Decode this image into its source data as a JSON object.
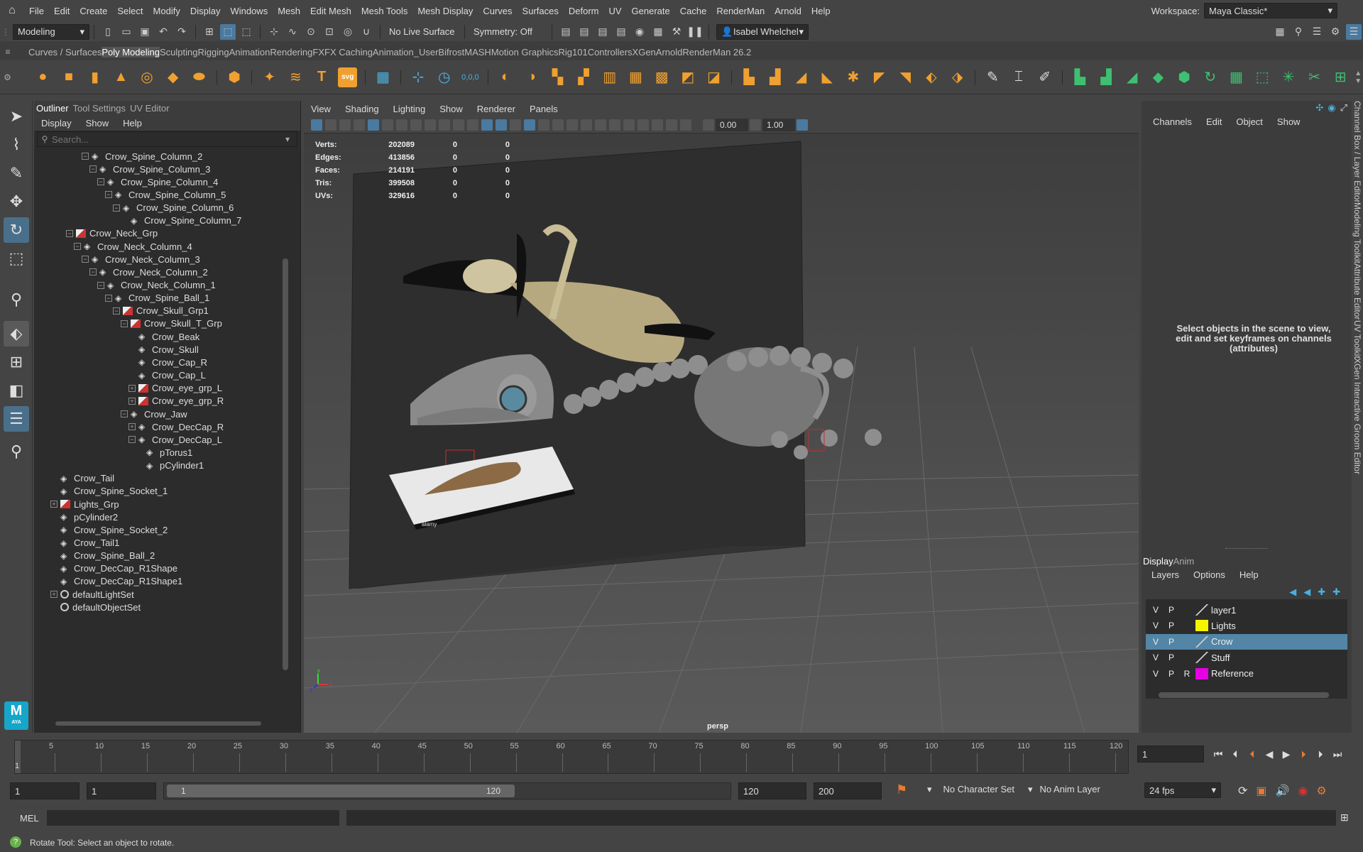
{
  "menubar": {
    "items": [
      "File",
      "Edit",
      "Create",
      "Select",
      "Modify",
      "Display",
      "Windows",
      "Mesh",
      "Edit Mesh",
      "Mesh Tools",
      "Mesh Display",
      "Curves",
      "Surfaces",
      "Deform",
      "UV",
      "Generate",
      "Cache",
      "RenderMan",
      "Arnold",
      "Help"
    ],
    "workspace_label": "Workspace:",
    "workspace_value": "Maya Classic*"
  },
  "statusline": {
    "mode": "Modeling",
    "live_surface": "No Live Surface",
    "symmetry": "Symmetry: Off",
    "user": "Isabel Whelchel"
  },
  "shelf": {
    "tabs": [
      "Curves / Surfaces",
      "Poly Modeling",
      "Sculpting",
      "Rigging",
      "Animation",
      "Rendering",
      "FX",
      "FX Caching",
      "Animation_User",
      "Bifrost",
      "MASH",
      "Motion Graphics",
      "Rig101",
      "Controllers",
      "XGen",
      "Arnold",
      "RenderMan 26.2"
    ],
    "active_tab": "Poly Modeling"
  },
  "outliner": {
    "tabs": [
      "Outliner",
      "Tool Settings",
      "UV Editor"
    ],
    "menu": [
      "Display",
      "Show",
      "Help"
    ],
    "search_placeholder": "Search...",
    "rows": [
      {
        "label": "Crow_Spine_Column_2",
        "indent": 5,
        "icon": "mesh",
        "toggle": "−"
      },
      {
        "label": "Crow_Spine_Column_3",
        "indent": 6,
        "icon": "mesh",
        "toggle": "−"
      },
      {
        "label": "Crow_Spine_Column_4",
        "indent": 7,
        "icon": "mesh",
        "toggle": "−"
      },
      {
        "label": "Crow_Spine_Column_5",
        "indent": 8,
        "icon": "mesh",
        "toggle": "−"
      },
      {
        "label": "Crow_Spine_Column_6",
        "indent": 9,
        "icon": "mesh",
        "toggle": "−"
      },
      {
        "label": "Crow_Spine_Column_7",
        "indent": 10,
        "icon": "mesh",
        "toggle": ""
      },
      {
        "label": "Crow_Neck_Grp",
        "indent": 3,
        "icon": "group",
        "toggle": "−"
      },
      {
        "label": "Crow_Neck_Column_4",
        "indent": 4,
        "icon": "mesh",
        "toggle": "−"
      },
      {
        "label": "Crow_Neck_Column_3",
        "indent": 5,
        "icon": "mesh",
        "toggle": "−"
      },
      {
        "label": "Crow_Neck_Column_2",
        "indent": 6,
        "icon": "mesh",
        "toggle": "−"
      },
      {
        "label": "Crow_Neck_Column_1",
        "indent": 7,
        "icon": "mesh",
        "toggle": "−"
      },
      {
        "label": "Crow_Spine_Ball_1",
        "indent": 8,
        "icon": "mesh",
        "toggle": "−"
      },
      {
        "label": "Crow_Skull_Grp1",
        "indent": 9,
        "icon": "group",
        "toggle": "−"
      },
      {
        "label": "Crow_Skull_T_Grp",
        "indent": 10,
        "icon": "group",
        "toggle": "−"
      },
      {
        "label": "Crow_Beak",
        "indent": 11,
        "icon": "mesh",
        "toggle": ""
      },
      {
        "label": "Crow_Skull",
        "indent": 11,
        "icon": "mesh",
        "toggle": ""
      },
      {
        "label": "Crow_Cap_R",
        "indent": 11,
        "icon": "mesh",
        "toggle": ""
      },
      {
        "label": "Crow_Cap_L",
        "indent": 11,
        "icon": "mesh",
        "toggle": ""
      },
      {
        "label": "Crow_eye_grp_L",
        "indent": 11,
        "icon": "group",
        "toggle": "+"
      },
      {
        "label": "Crow_eye_grp_R",
        "indent": 11,
        "icon": "group",
        "toggle": "+"
      },
      {
        "label": "Crow_Jaw",
        "indent": 10,
        "icon": "mesh",
        "toggle": "−"
      },
      {
        "label": "Crow_DecCap_R",
        "indent": 11,
        "icon": "mesh",
        "toggle": "+"
      },
      {
        "label": "Crow_DecCap_L",
        "indent": 11,
        "icon": "mesh",
        "toggle": "−"
      },
      {
        "label": "pTorus1",
        "indent": 12,
        "icon": "mesh",
        "toggle": ""
      },
      {
        "label": "pCylinder1",
        "indent": 12,
        "icon": "mesh",
        "toggle": ""
      },
      {
        "label": "Crow_Tail",
        "indent": 1,
        "icon": "mesh",
        "toggle": ""
      },
      {
        "label": "Crow_Spine_Socket_1",
        "indent": 1,
        "icon": "mesh",
        "toggle": ""
      },
      {
        "label": "Lights_Grp",
        "indent": 1,
        "icon": "group",
        "toggle": "+"
      },
      {
        "label": "pCylinder2",
        "indent": 1,
        "icon": "mesh",
        "toggle": ""
      },
      {
        "label": "Crow_Spine_Socket_2",
        "indent": 1,
        "icon": "mesh",
        "toggle": ""
      },
      {
        "label": "Crow_Tail1",
        "indent": 1,
        "icon": "mesh",
        "toggle": ""
      },
      {
        "label": "Crow_Spine_Ball_2",
        "indent": 1,
        "icon": "mesh",
        "toggle": ""
      },
      {
        "label": "Crow_DecCap_R1Shape",
        "indent": 1,
        "icon": "mesh",
        "toggle": ""
      },
      {
        "label": "Crow_DecCap_R1Shape1",
        "indent": 1,
        "icon": "mesh",
        "toggle": ""
      },
      {
        "label": "defaultLightSet",
        "indent": 1,
        "icon": "set",
        "toggle": "+"
      },
      {
        "label": "defaultObjectSet",
        "indent": 1,
        "icon": "set",
        "toggle": ""
      }
    ]
  },
  "viewport": {
    "menu": [
      "View",
      "Shading",
      "Lighting",
      "Show",
      "Renderer",
      "Panels"
    ],
    "field_a": "0.00",
    "field_b": "1.00",
    "camera": "persp",
    "stats": [
      {
        "label": "Verts:",
        "v1": "202089",
        "v2": "0",
        "v3": "0"
      },
      {
        "label": "Edges:",
        "v1": "413856",
        "v2": "0",
        "v3": "0"
      },
      {
        "label": "Faces:",
        "v1": "214191",
        "v2": "0",
        "v3": "0"
      },
      {
        "label": "Tris:",
        "v1": "399508",
        "v2": "0",
        "v3": "0"
      },
      {
        "label": "UVs:",
        "v1": "329616",
        "v2": "0",
        "v3": "0"
      }
    ],
    "image_watermark": "alamy"
  },
  "channelbox": {
    "menu": [
      "Channels",
      "Edit",
      "Object",
      "Show"
    ],
    "hint": "Select objects in the scene to view, edit and set keyframes on channels (attributes)",
    "layer_tabs": [
      "Display",
      "Anim"
    ],
    "layer_menu": [
      "Layers",
      "Options",
      "Help"
    ],
    "layers": [
      {
        "v": "V",
        "p": "P",
        "r": "",
        "name": "layer1",
        "color": "",
        "selected": false
      },
      {
        "v": "V",
        "p": "P",
        "r": "",
        "name": "Lights",
        "color": "#f5f500",
        "selected": false
      },
      {
        "v": "V",
        "p": "P",
        "r": "",
        "name": "Crow",
        "color": "",
        "selected": true
      },
      {
        "v": "V",
        "p": "P",
        "r": "",
        "name": "Stuff",
        "color": "",
        "selected": false
      },
      {
        "v": "V",
        "p": "P",
        "r": "R",
        "name": "Reference",
        "color": "#e600e6",
        "selected": false
      }
    ]
  },
  "sidetabs": [
    "Channel Box / Layer Editor",
    "Modeling Toolkit",
    "Attribute Editor",
    "UV Toolkit",
    "XGen Interactive Groom Editor"
  ],
  "timeline": {
    "ticks": [
      "5",
      "10",
      "15",
      "20",
      "25",
      "30",
      "35",
      "40",
      "45",
      "50",
      "55",
      "60",
      "65",
      "70",
      "75",
      "80",
      "85",
      "90",
      "95",
      "100",
      "105",
      "110",
      "115",
      "120"
    ],
    "current_frame_marker": "1",
    "current_frame": "1"
  },
  "range": {
    "start": "1",
    "inner_start": "1",
    "slider_start": "1",
    "slider_end": "120",
    "end": "120",
    "outer_end": "200",
    "character_set": "No Character Set",
    "anim_layer": "No Anim Layer",
    "fps": "24 fps"
  },
  "cmdline": {
    "label": "MEL"
  },
  "helpline": {
    "text": "Rotate Tool: Select an object to rotate."
  },
  "logo": {
    "letter": "M",
    "sub": "AYA"
  },
  "colors": {
    "accent": "#4a7aa0",
    "selected_row": "#5285a6",
    "bg": "#444444"
  }
}
